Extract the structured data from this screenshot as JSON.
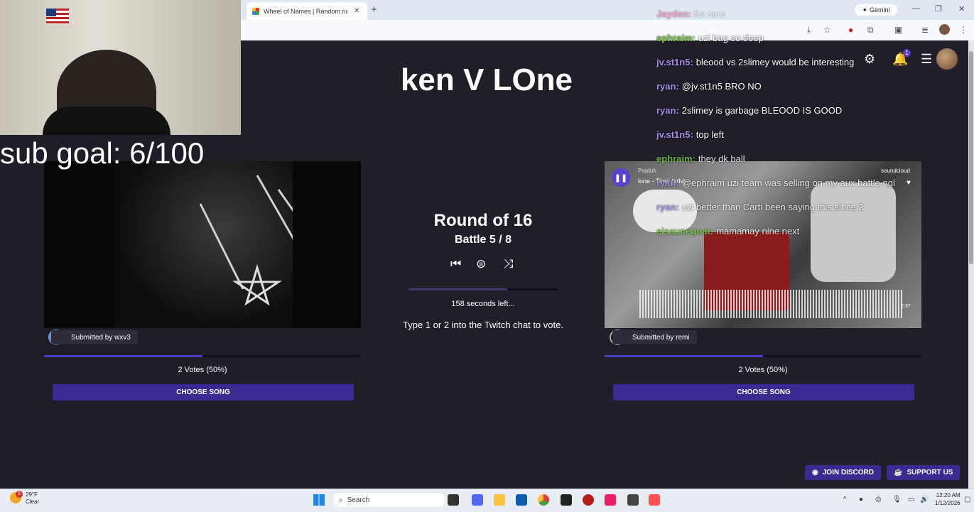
{
  "browser": {
    "tab_title": "Wheel of Names | Random name picker",
    "tab_close": "✕",
    "new_tab": "+",
    "gemini_label": "Gemini",
    "window_controls": [
      "—",
      "❐",
      "✕"
    ]
  },
  "app": {
    "matchup_title": "ken V LOne",
    "round_label": "Round of 16",
    "battle_label": "Battle 5 / 8",
    "time_left": "158 seconds left...",
    "time_fraction": 0.66,
    "vote_instructions": "Type 1 or 2 into the Twitch chat to vote.",
    "notification_count": "1",
    "left_entry": {
      "submitted_by": "Submitted by wxv3",
      "votes": "2 Votes (50%)",
      "vote_fraction": 0.5,
      "choose_label": "CHOOSE SONG"
    },
    "right_entry": {
      "submitted_by": "Submitted by remi",
      "votes": "2 Votes (50%)",
      "vote_fraction": 0.5,
      "choose_label": "CHOOSE SONG",
      "player_artist": "Praduh",
      "player_track": "lone - Time (xdv)",
      "player_time": "2:37",
      "player_brand": "soundcloud"
    },
    "discord_label": "JOIN DISCORD",
    "support_label": "SUPPORT US",
    "accent_color": "#3a2b93"
  },
  "overlay": {
    "sub_goal": "sub goal: 6/100",
    "chat": [
      {
        "user": "Jayden:",
        "text": "for sure",
        "color": "#ff6aa0"
      },
      {
        "user": "ephraim:",
        "text": "uzi bag so deep",
        "color": "#7ac943"
      },
      {
        "user": "jv.st1n5:",
        "text": "bleood vs 2slimey would be interesting",
        "color": "#a98be8"
      },
      {
        "user": "ryan:",
        "text": "@jv.st1n5 BRO NO",
        "color": "#a98be8"
      },
      {
        "user": "ryan:",
        "text": "2slimey is garbage BLEOOD IS GOOD",
        "color": "#a98be8"
      },
      {
        "user": "jv.st1n5:",
        "text": "top left",
        "color": "#a98be8"
      },
      {
        "user": "ephraim:",
        "text": "they dk ball",
        "color": "#7ac943"
      },
      {
        "user": "ryan:",
        "text": "@ephraim uzi team was selling on my aux battle ngl",
        "color": "#a98be8"
      },
      {
        "user": "ryan:",
        "text": "uzi better than Carti been saying this since 2",
        "color": "#a98be8"
      },
      {
        "user": "eisaunegoat:",
        "text": "mamamay nine next",
        "color": "#7ac943"
      }
    ]
  },
  "taskbar": {
    "weather_temp": "29°F",
    "weather_desc": "Clear",
    "weather_badge": "5",
    "search_label": "Search",
    "time": "12:20 AM",
    "date": "1/12/2026"
  }
}
